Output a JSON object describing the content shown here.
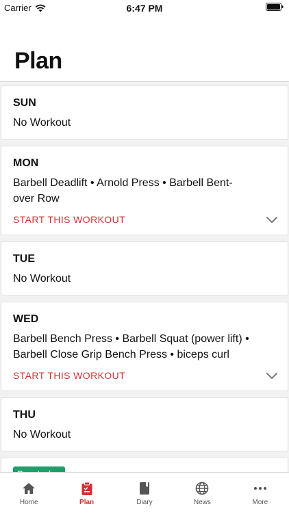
{
  "status_bar": {
    "carrier": "Carrier",
    "time": "6:47 PM"
  },
  "header": {
    "title": "Plan"
  },
  "days": [
    {
      "day": "SUN",
      "description": "No Workout"
    },
    {
      "day": "MON",
      "description": "Barbell Deadlift • Arnold Press • Barbell Bent-over Row",
      "action": "START THIS WORKOUT"
    },
    {
      "day": "TUE",
      "description": "No Workout"
    },
    {
      "day": "WED",
      "description": "Barbell Bench Press • Barbell Squat (power lift) • Barbell Close Grip Bench Press • biceps curl",
      "action": "START THIS WORKOUT"
    },
    {
      "day": "THU",
      "description": "No Workout"
    }
  ],
  "due_badge": "Due today",
  "tabs": [
    {
      "label": "Home",
      "icon": "home-icon"
    },
    {
      "label": "Plan",
      "icon": "clipboard-icon",
      "active": true
    },
    {
      "label": "Diary",
      "icon": "book-icon"
    },
    {
      "label": "News",
      "icon": "globe-icon"
    },
    {
      "label": "More",
      "icon": "more-icon"
    }
  ],
  "colors": {
    "accent": "#d32f2f",
    "badge": "#1f9e6a",
    "inactive": "#555555"
  }
}
